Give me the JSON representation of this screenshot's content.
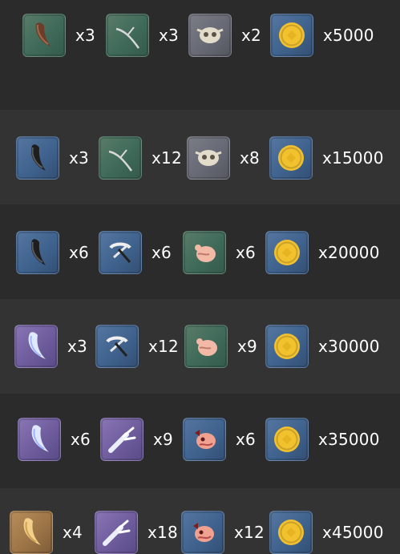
{
  "rows": [
    {
      "items": [
        {
          "icon": "dark-fang-icon",
          "rarity": "green",
          "qty": "x3"
        },
        {
          "icon": "twig-icon",
          "rarity": "green",
          "qty": "x3"
        },
        {
          "icon": "skull-icon",
          "rarity": "gray",
          "qty": "x2"
        },
        {
          "icon": "gold-coin-icon",
          "rarity": "blue",
          "qty": "x5000"
        }
      ]
    },
    {
      "items": [
        {
          "icon": "dark-fang-icon",
          "rarity": "blue",
          "qty": "x3"
        },
        {
          "icon": "twig-icon",
          "rarity": "green",
          "qty": "x12"
        },
        {
          "icon": "skull-icon",
          "rarity": "gray",
          "qty": "x8"
        },
        {
          "icon": "gold-coin-icon",
          "rarity": "blue",
          "qty": "x15000"
        }
      ]
    },
    {
      "items": [
        {
          "icon": "dark-fang-icon",
          "rarity": "blue",
          "qty": "x6"
        },
        {
          "icon": "crossed-bones-icon",
          "rarity": "blue",
          "qty": "x6"
        },
        {
          "icon": "pink-creature-icon",
          "rarity": "green",
          "qty": "x6"
        },
        {
          "icon": "gold-coin-icon",
          "rarity": "blue",
          "qty": "x20000"
        }
      ]
    },
    {
      "items": [
        {
          "icon": "ice-fang-icon",
          "rarity": "purple",
          "qty": "x3"
        },
        {
          "icon": "crossed-bones-icon",
          "rarity": "blue",
          "qty": "x12"
        },
        {
          "icon": "pink-creature-icon",
          "rarity": "green",
          "qty": "x9"
        },
        {
          "icon": "gold-coin-icon",
          "rarity": "blue",
          "qty": "x30000"
        }
      ]
    },
    {
      "items": [
        {
          "icon": "ice-fang-icon",
          "rarity": "purple",
          "qty": "x6"
        },
        {
          "icon": "white-branch-icon",
          "rarity": "purple",
          "qty": "x9"
        },
        {
          "icon": "red-creature-icon",
          "rarity": "blue",
          "qty": "x6"
        },
        {
          "icon": "gold-coin-icon",
          "rarity": "blue",
          "qty": "x35000"
        }
      ]
    },
    {
      "items": [
        {
          "icon": "golden-fang-icon",
          "rarity": "orange",
          "qty": "x4"
        },
        {
          "icon": "white-branch-icon",
          "rarity": "purple",
          "qty": "x18"
        },
        {
          "icon": "red-creature-icon",
          "rarity": "blue",
          "qty": "x12"
        },
        {
          "icon": "gold-coin-icon",
          "rarity": "blue",
          "qty": "x45000"
        }
      ]
    }
  ]
}
